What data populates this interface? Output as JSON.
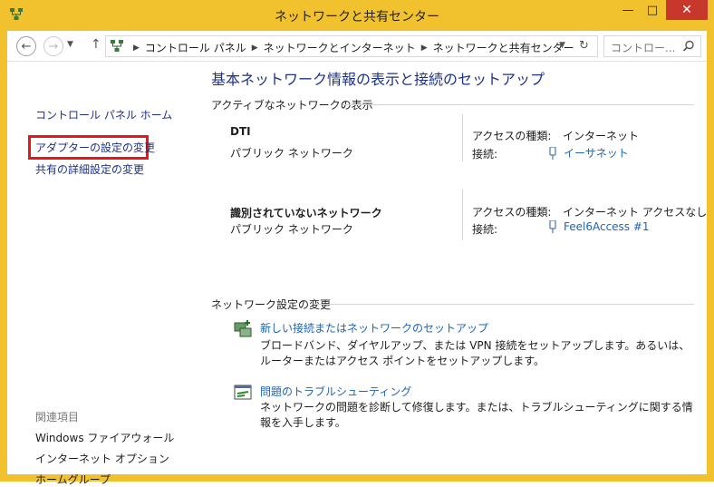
{
  "window": {
    "title": "ネットワークと共有センター",
    "controls": {
      "minimize": "—",
      "maximize": "□",
      "close": "✕"
    }
  },
  "address": {
    "crumbs": [
      "コントロール パネル",
      "ネットワークとインターネット",
      "ネットワークと共有センター"
    ],
    "search_placeholder": "コントロー..."
  },
  "sidebar": {
    "home": "コントロール パネル ホーム",
    "adapter": "アダプターの設定の変更",
    "sharing": "共有の詳細設定の変更",
    "related_heading": "関連項目",
    "related": [
      "Windows ファイアウォール",
      "インターネット オプション",
      "ホームグループ"
    ]
  },
  "main": {
    "title": "基本ネットワーク情報の表示と接続のセットアップ",
    "active_heading": "アクティブなネットワークの表示",
    "networks": [
      {
        "name": "DTI",
        "type": "パブリック ネットワーク",
        "access_label": "アクセスの種類:",
        "access_value": "インターネット",
        "conn_label": "接続:",
        "conn_value": "イーサネット"
      },
      {
        "name": "識別されていないネットワーク",
        "type": "パブリック ネットワーク",
        "access_label": "アクセスの種類:",
        "access_value": "インターネット アクセスなし",
        "conn_label": "接続:",
        "conn_value": "Feel6Access #1"
      }
    ],
    "settings_heading": "ネットワーク設定の変更",
    "tasks": [
      {
        "link": "新しい接続またはネットワークのセットアップ",
        "desc": "ブロードバンド、ダイヤルアップ、または VPN 接続をセットアップします。あるいは、ルーターまたはアクセス ポイントをセットアップします。"
      },
      {
        "link": "問題のトラブルシューティング",
        "desc": "ネットワークの問題を診断して修復します。または、トラブルシューティングに関する情報を入手します。"
      }
    ]
  },
  "colors": {
    "frame": "#f2c12e",
    "close": "#c7372b",
    "link": "#1e64b4",
    "highlight": "#e8161b"
  }
}
